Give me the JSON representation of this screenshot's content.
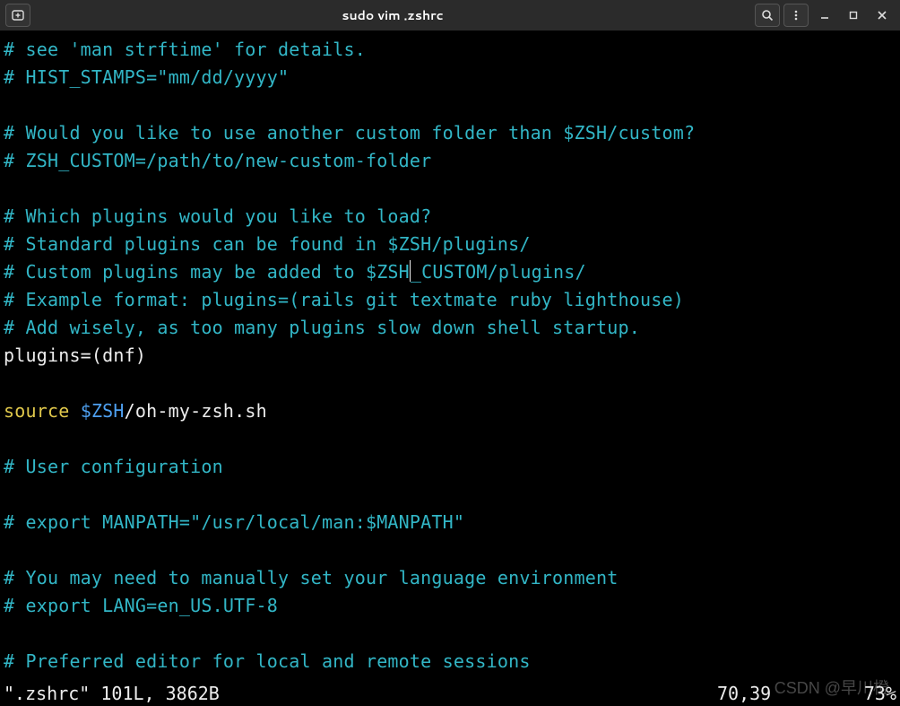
{
  "window": {
    "title": "sudo vim .zshrc"
  },
  "icons": {
    "new_tab": "new-tab-icon",
    "search": "search-icon",
    "menu": "menu-icon",
    "minimize": "minimize-icon",
    "maximize": "maximize-icon",
    "close": "close-icon"
  },
  "editor": {
    "lines": [
      {
        "type": "comment",
        "text": "# see 'man strftime' for details."
      },
      {
        "type": "comment",
        "text": "# HIST_STAMPS=\"mm/dd/yyyy\""
      },
      {
        "type": "blank",
        "text": ""
      },
      {
        "type": "comment",
        "text": "# Would you like to use another custom folder than $ZSH/custom?"
      },
      {
        "type": "comment",
        "text": "# ZSH_CUSTOM=/path/to/new-custom-folder"
      },
      {
        "type": "blank",
        "text": ""
      },
      {
        "type": "comment",
        "text": "# Which plugins would you like to load?"
      },
      {
        "type": "comment",
        "text": "# Standard plugins can be found in $ZSH/plugins/"
      },
      {
        "type": "comment_cursor",
        "pre": "# Custom plugins may be added to $ZSH",
        "post": "_CUSTOM/plugins/"
      },
      {
        "type": "comment",
        "text": "# Example format: plugins=(rails git textmate ruby lighthouse)"
      },
      {
        "type": "comment",
        "text": "# Add wisely, as too many plugins slow down shell startup."
      },
      {
        "type": "plain",
        "text": "plugins=(dnf)"
      },
      {
        "type": "blank",
        "text": ""
      },
      {
        "type": "source",
        "kw": "source",
        "var": "$ZSH",
        "rest": "/oh-my-zsh.sh"
      },
      {
        "type": "blank",
        "text": ""
      },
      {
        "type": "comment",
        "text": "# User configuration"
      },
      {
        "type": "blank",
        "text": ""
      },
      {
        "type": "comment",
        "text": "# export MANPATH=\"/usr/local/man:$MANPATH\""
      },
      {
        "type": "blank",
        "text": ""
      },
      {
        "type": "comment",
        "text": "# You may need to manually set your language environment"
      },
      {
        "type": "comment",
        "text": "# export LANG=en_US.UTF-8"
      },
      {
        "type": "blank",
        "text": ""
      },
      {
        "type": "comment",
        "text": "# Preferred editor for local and remote sessions"
      }
    ]
  },
  "status": {
    "left": "\".zshrc\" 101L, 3862B",
    "mid": "70,39",
    "right": "73%"
  },
  "watermark": "CSDN @早川橙"
}
